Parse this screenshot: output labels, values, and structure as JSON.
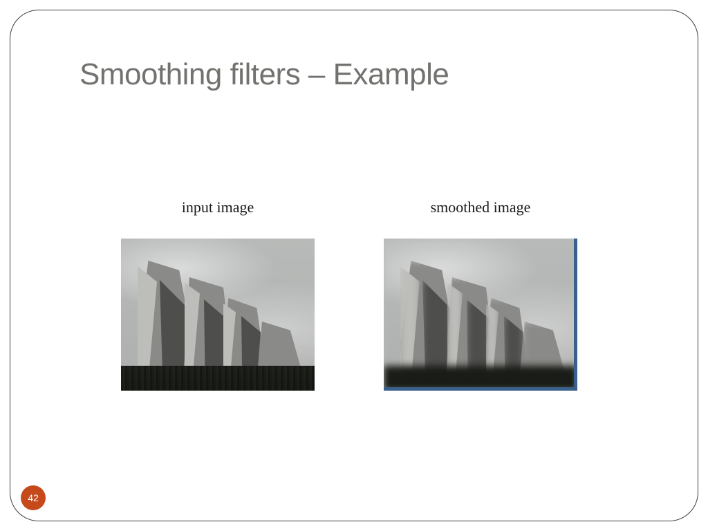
{
  "title": "Smoothing filters – Example",
  "figures": {
    "left": {
      "caption": "input image"
    },
    "right": {
      "caption": "smoothed image"
    }
  },
  "page_number": "42"
}
